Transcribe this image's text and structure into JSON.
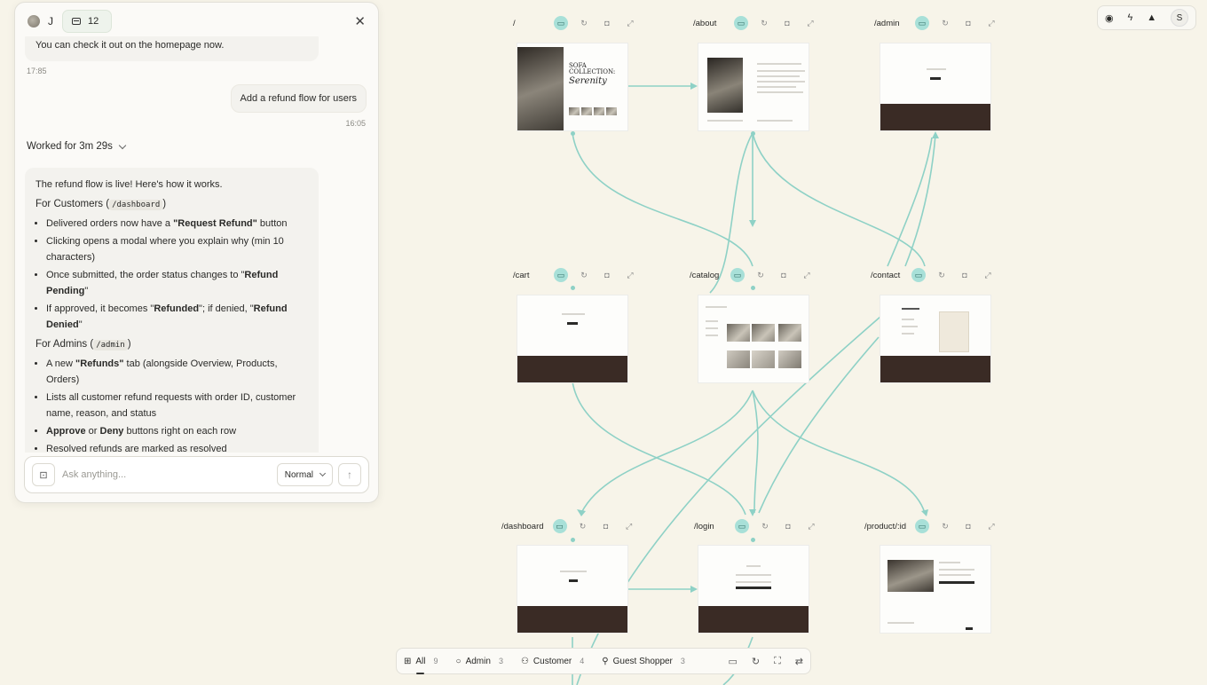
{
  "chat": {
    "user_initial": "J",
    "badge_count": "12",
    "prev_message": "You can check it out on the homepage now.",
    "prev_time": "17:85",
    "user_message": "Add a refund flow for users",
    "user_time": "16:05",
    "worked_for": "Worked for 3m 29s",
    "intro": "The refund flow is live! Here's how it works.",
    "customers_heading": "For Customers (",
    "customers_code": "/dashboard",
    "admins_heading": "For Admins (",
    "admins_code": "/admin",
    "close_paren": ")",
    "customer_items": [
      {
        "pre": "Delivered orders now have a ",
        "bold": "\"Request Refund\"",
        "post": " button"
      },
      {
        "pre": "Clicking opens a modal where you explain why (min 10 characters)",
        "bold": "",
        "post": ""
      },
      {
        "pre": "Once submitted, the order status changes to \"",
        "bold": "Refund Pending",
        "post": "\""
      },
      {
        "pre": "If approved, it becomes \"",
        "bold": "Refunded",
        "post": "\"; if denied, \"",
        "bold2": "Refund Denied",
        "post2": "\""
      }
    ],
    "admin_items": [
      {
        "pre": "A new ",
        "bold": "\"Refunds\"",
        "post": " tab (alongside Overview, Products, Orders)"
      },
      {
        "pre": "Lists all customer refund requests with order ID, customer name, reason, and status",
        "bold": "",
        "post": ""
      },
      {
        "pre": "",
        "bold": "Approve",
        "post": " or ",
        "bold2": "Deny",
        "post2": " buttons right on each row"
      },
      {
        "pre": "Resolved refunds are marked as resolved",
        "bold": "",
        "post": ""
      }
    ],
    "input_placeholder": "Ask anything...",
    "mode": "Normal"
  },
  "canvas": {
    "routes": [
      "/",
      "/about",
      "/admin",
      "/cart",
      "/catalog",
      "/contact",
      "/dashboard",
      "/login",
      "/product/:id"
    ],
    "home_title_1": "SOFA COLLECTION:",
    "home_title_2": "Serenity",
    "accent_color": "#8ed1c6"
  },
  "toolbar_right": {
    "avatar_initial": "S"
  },
  "filters": [
    {
      "label": "All",
      "count": "9"
    },
    {
      "label": "Admin",
      "count": "3"
    },
    {
      "label": "Customer",
      "count": "4"
    },
    {
      "label": "Guest Shopper",
      "count": "3"
    }
  ]
}
